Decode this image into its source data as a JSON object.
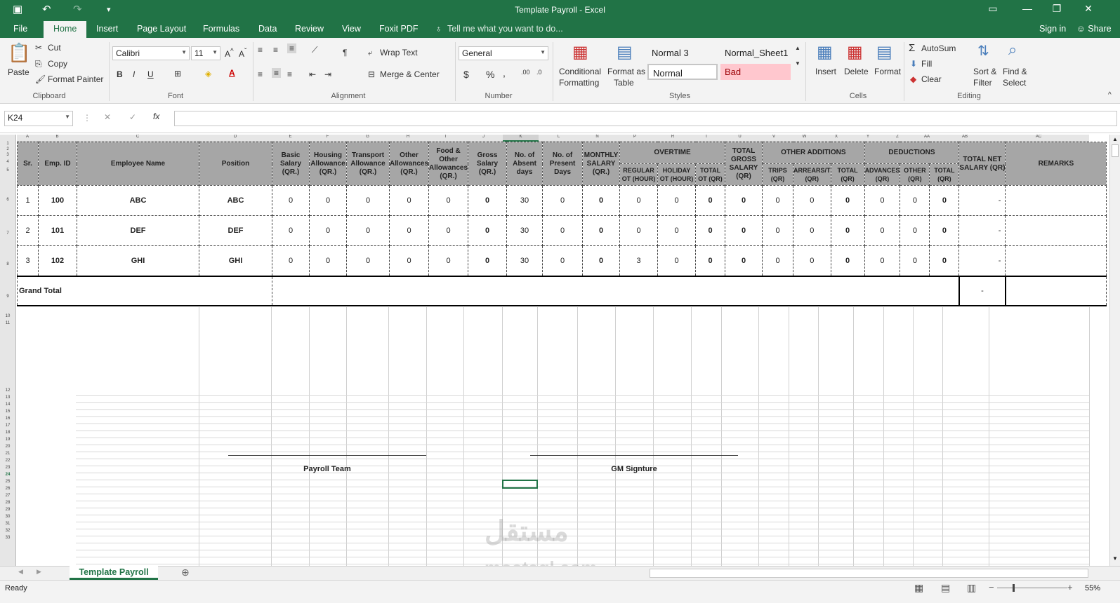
{
  "window": {
    "title": "Template Payroll - Excel"
  },
  "menu": {
    "file": "File",
    "home": "Home",
    "insert": "Insert",
    "page_layout": "Page Layout",
    "formulas": "Formulas",
    "data": "Data",
    "review": "Review",
    "view": "View",
    "foxit": "Foxit PDF",
    "tell_me": "Tell me what you want to do...",
    "sign_in": "Sign in",
    "share": "Share"
  },
  "ribbon": {
    "clipboard": {
      "paste": "Paste",
      "cut": "Cut",
      "copy": "Copy",
      "format_painter": "Format Painter",
      "label": "Clipboard"
    },
    "font": {
      "name": "Calibri",
      "size": "11",
      "bold": "B",
      "italic": "I",
      "underline": "U",
      "label": "Font"
    },
    "alignment": {
      "wrap_text": "Wrap Text",
      "merge_center": "Merge & Center",
      "label": "Alignment"
    },
    "number": {
      "format": "General",
      "currency": "$",
      "percent": "%",
      "comma": ",",
      "label": "Number"
    },
    "styles": {
      "conditional": "Conditional",
      "conditional2": "Formatting",
      "format_as": "Format as",
      "table": "Table",
      "normal3": "Normal 3",
      "normal_sheet1": "Normal_Sheet1",
      "normal": "Normal",
      "bad": "Bad",
      "label": "Styles"
    },
    "cells": {
      "insert": "Insert",
      "delete": "Delete",
      "format": "Format",
      "label": "Cells"
    },
    "editing": {
      "autosum": "AutoSum",
      "fill": "Fill",
      "clear": "Clear",
      "sort": "Sort &",
      "filter": "Filter",
      "find": "Find &",
      "select": "Select",
      "label": "Editing"
    }
  },
  "formula_bar": {
    "name_box": "K24",
    "fx": "fx",
    "content": ""
  },
  "columns": [
    "A",
    "B",
    "C",
    "D",
    "E",
    "F",
    "G",
    "H",
    "I",
    "J",
    "K",
    "L",
    "N",
    "P",
    "R",
    "T",
    "U",
    "V",
    "W",
    "X",
    "Y",
    "Z",
    "AA",
    "AB",
    "AC"
  ],
  "rows": [
    "1",
    "2",
    "3",
    "4",
    "5",
    "6",
    "7",
    "8",
    "9",
    "10",
    "11",
    "12",
    "13",
    "14",
    "15",
    "16",
    "17",
    "18",
    "19",
    "20",
    "21",
    "22",
    "23",
    "24",
    "25",
    "26",
    "27",
    "28",
    "29",
    "30",
    "31",
    "32",
    "33"
  ],
  "headers": {
    "sr": "Sr.",
    "emp_id": "Emp. ID",
    "name": "Employee Name",
    "position": "Position",
    "basic": "Basic Salary (QR.)",
    "housing": "Housing Allowance (QR.)",
    "transport": "Transport Allowance (QR.)",
    "other": "Other Allowances (QR.)",
    "food": "Food & Other Allowances (QR.)",
    "gross": "Gross Salary (QR.)",
    "absent": "No. of Absent days",
    "present": "No. of Present Days",
    "monthly": "MONTHLY SALARY (QR.)",
    "overtime": "OVERTIME",
    "regular_ot": "REGULAR OT (HOUR)",
    "holiday_ot": "HOLIDAY OT (HOUR)",
    "total_ot": "TOTAL OT (QR)",
    "total_gross": "TOTAL GROSS SALARY (QR)",
    "other_additions": "OTHER ADDITIONS",
    "trips": "TRIPS (QR)",
    "arrears": "ARREARS/T (QR)",
    "total_add": "TOTAL (QR)",
    "deductions": "DEDUCTIONS",
    "advances": "ADVANCES (QR)",
    "other_ded": "OTHER (QR)",
    "total_ded": "TOTAL (QR)",
    "net": "TOTAL NET SALARY (QR)",
    "remarks": "REMARKS"
  },
  "employees": [
    {
      "sr": "1",
      "id": "100",
      "name": "ABC",
      "position": "ABC",
      "basic": "0",
      "housing": "0",
      "transport": "0",
      "other": "0",
      "food": "0",
      "gross": "0",
      "absent": "30",
      "present": "0",
      "monthly": "0",
      "reg_ot": "0",
      "hol_ot": "0",
      "tot_ot": "0",
      "tot_gross": "0",
      "trips": "0",
      "arrears": "0",
      "tot_add": "0",
      "adv": "0",
      "oth": "0",
      "tot_ded": "0",
      "net": "-"
    },
    {
      "sr": "2",
      "id": "101",
      "name": "DEF",
      "position": "DEF",
      "basic": "0",
      "housing": "0",
      "transport": "0",
      "other": "0",
      "food": "0",
      "gross": "0",
      "absent": "30",
      "present": "0",
      "monthly": "0",
      "reg_ot": "0",
      "hol_ot": "0",
      "tot_ot": "0",
      "tot_gross": "0",
      "trips": "0",
      "arrears": "0",
      "tot_add": "0",
      "adv": "0",
      "oth": "0",
      "tot_ded": "0",
      "net": "-"
    },
    {
      "sr": "3",
      "id": "102",
      "name": "GHI",
      "position": "GHI",
      "basic": "0",
      "housing": "0",
      "transport": "0",
      "other": "0",
      "food": "0",
      "gross": "0",
      "absent": "30",
      "present": "0",
      "monthly": "0",
      "reg_ot": "3",
      "hol_ot": "0",
      "tot_ot": "0",
      "tot_gross": "0",
      "trips": "0",
      "arrears": "0",
      "tot_add": "0",
      "adv": "0",
      "oth": "0",
      "tot_ded": "0",
      "net": "-"
    }
  ],
  "grand_total": {
    "label": "Grand Total",
    "value": "-"
  },
  "signatures": {
    "payroll": "Payroll Team",
    "gm": "GM Signture"
  },
  "sheet_tab": "Template Payroll",
  "status": {
    "ready": "Ready",
    "zoom": "55%"
  },
  "watermark": {
    "arabic": "مستقل",
    "latin": "mostaql.com"
  },
  "colors": {
    "excel_green": "#217346",
    "header_gray": "#a6a6a6",
    "bad_fill": "#ffc7ce"
  }
}
